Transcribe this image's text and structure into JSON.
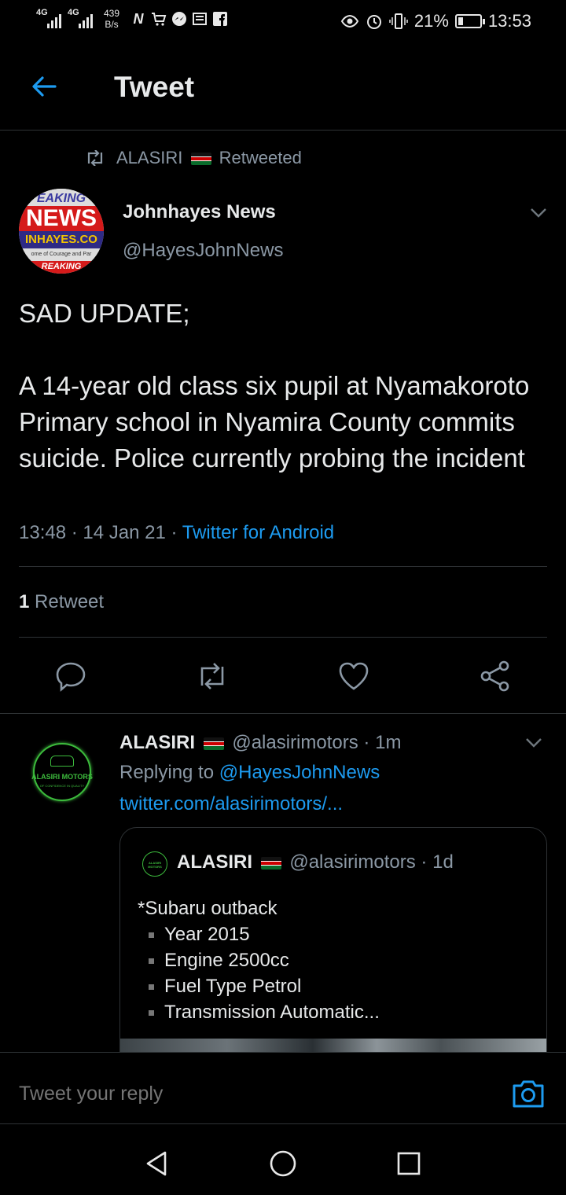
{
  "status_bar": {
    "net1": "4G",
    "net2": "4G",
    "speed_value": "439",
    "speed_unit": "B/s",
    "battery": "21%",
    "time": "13:53",
    "icons": [
      "signal-icon",
      "news-app-icon",
      "cart-icon",
      "messenger-icon",
      "news-icon",
      "facebook-icon",
      "eye-icon",
      "alarm-icon",
      "vibrate-icon",
      "battery-icon"
    ]
  },
  "header": {
    "title": "Tweet",
    "back_icon": "arrow-left-icon"
  },
  "retweet_context": {
    "user": "ALASIRI",
    "suffix": "Retweeted",
    "icon": "retweet-icon"
  },
  "tweet": {
    "avatar": {
      "top": "EAKING",
      "main": "NEWS",
      "sub": "INHAYES.CO",
      "caption": "ome of Courage and Par",
      "bottom": "REAKING"
    },
    "author_name": "Johnhayes News",
    "author_handle": "@HayesJohnNews",
    "text": "SAD UPDATE;\n\nA 14-year old class six pupil at Nyamakoroto Primary school in Nyamira County commits suicide. Police currently probing the incident",
    "time": "13:48",
    "date": "14 Jan 21",
    "source": "Twitter for Android",
    "retweet_count": "1",
    "retweet_label": "Retweet"
  },
  "actions": [
    "reply-icon",
    "retweet-icon",
    "like-icon",
    "share-icon"
  ],
  "reply": {
    "avatar_label": "ALASIRI MOTORS",
    "avatar_sub": "OF CONFIDENCE IN QUALITY",
    "name": "ALASIRI",
    "handle": "@alasirimotors",
    "age": "1m",
    "replying_prefix": "Replying to",
    "replying_handle": "@HayesJohnNews",
    "link": "twitter.com/alasirimotors/..."
  },
  "quote": {
    "avatar_label": "ALASIRI MOTORS",
    "name": "ALASIRI",
    "handle": "@alasirimotors",
    "age": "1d",
    "title": "*Subaru outback",
    "items": [
      "Year 2015",
      "Engine 2500cc",
      "Fuel Type Petrol",
      "Transmission Automatic..."
    ]
  },
  "compose": {
    "placeholder": "Tweet your reply",
    "camera_icon": "camera-icon"
  },
  "colors": {
    "background": "#000000",
    "accent": "#1d9bf0",
    "secondary_text": "#8b98a5",
    "divider": "#2f3336"
  },
  "nav_icons": [
    "back-triangle-icon",
    "home-circle-icon",
    "recents-square-icon"
  ]
}
